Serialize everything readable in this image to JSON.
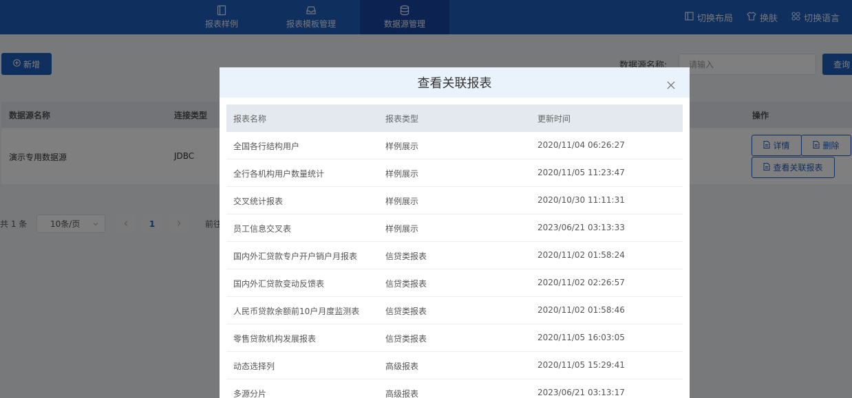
{
  "topnav": {
    "tabs": [
      {
        "label": "报表样例",
        "icon": "report-book-icon"
      },
      {
        "label": "报表模板管理",
        "icon": "tray-icon"
      },
      {
        "label": "数据源管理",
        "icon": "database-icon"
      }
    ],
    "right": {
      "layout_label": "切换布局",
      "skin_label": "换肤",
      "lang_label": "切换语言"
    }
  },
  "toolbar": {
    "add_label": "新增",
    "search_label": "数据源名称:",
    "search_placeholder": "请输入",
    "query_label": "查询"
  },
  "grid": {
    "headers": [
      "数据源名称",
      "连接类型",
      "操作"
    ],
    "rows": [
      {
        "name": "演示专用数据源",
        "type": "JDBC"
      }
    ],
    "actions": {
      "detail": "详情",
      "delete": "删除",
      "related": "查看关联报表"
    }
  },
  "pager": {
    "total": "共 1 条",
    "page_size": "10条/页",
    "current_page": "1",
    "goto": "前往"
  },
  "modal": {
    "title": "查看关联报表",
    "headers": [
      "报表名称",
      "报表类型",
      "更新时间"
    ],
    "rows": [
      {
        "name": "全国各行结构用户",
        "type": "样例展示",
        "time": "2020/11/04 06:26:27"
      },
      {
        "name": "全行各机构用户数量统计",
        "type": "样例展示",
        "time": "2020/11/05 11:23:47"
      },
      {
        "name": "交叉统计报表",
        "type": "样例展示",
        "time": "2020/10/30 11:11:31"
      },
      {
        "name": "员工信息交叉表",
        "type": "样例展示",
        "time": "2023/06/21 03:13:33"
      },
      {
        "name": "国内外汇贷款专户开户销户月报表",
        "type": "信贷类报表",
        "time": "2020/11/02 01:58:24"
      },
      {
        "name": "国内外汇贷款变动反馈表",
        "type": "信贷类报表",
        "time": "2020/11/02 02:26:57"
      },
      {
        "name": "人民币贷款余额前10户月度监测表",
        "type": "信贷类报表",
        "time": "2020/11/02 01:58:46"
      },
      {
        "name": "零售贷款机构发展报表",
        "type": "信贷类报表",
        "time": "2020/11/05 16:03:05"
      },
      {
        "name": "动态选择列",
        "type": "高级报表",
        "time": "2020/11/05 15:29:41"
      },
      {
        "name": "多源分片",
        "type": "高级报表",
        "time": "2023/06/21 03:13:17"
      }
    ]
  }
}
